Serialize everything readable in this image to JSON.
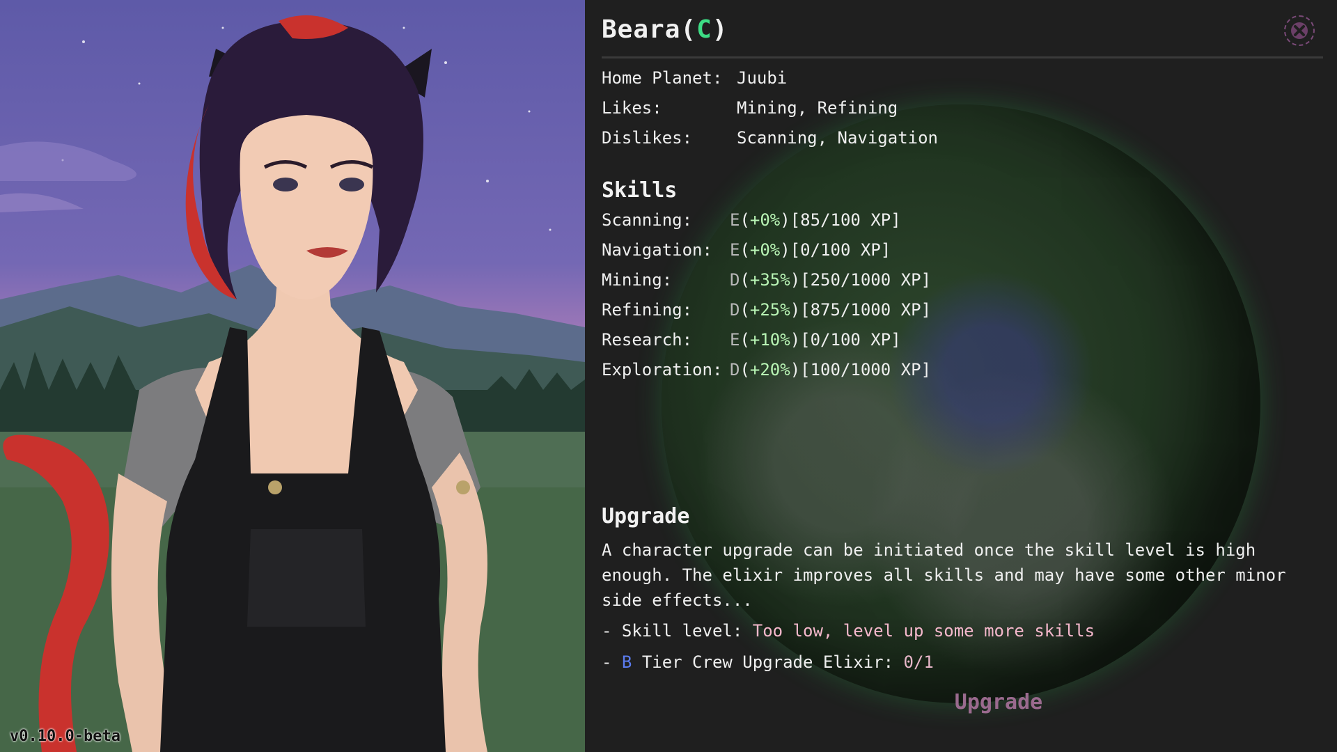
{
  "version": "v0.10.0-beta",
  "character": {
    "name": "Beara",
    "tier": "C",
    "home_planet_label": "Home Planet:",
    "home_planet": "Juubi",
    "likes_label": "Likes:",
    "likes": "Mining, Refining",
    "dislikes_label": "Dislikes:",
    "dislikes": "Scanning, Navigation"
  },
  "skills": {
    "heading": "Skills",
    "items": [
      {
        "label": "Scanning:",
        "grade": "E",
        "bonus": "+0%",
        "xp": "85/100 XP"
      },
      {
        "label": "Navigation:",
        "grade": "E",
        "bonus": "+0%",
        "xp": "0/100 XP"
      },
      {
        "label": "Mining:",
        "grade": "D",
        "bonus": "+35%",
        "xp": "250/1000 XP"
      },
      {
        "label": "Refining:",
        "grade": "D",
        "bonus": "+25%",
        "xp": "875/1000 XP"
      },
      {
        "label": "Research:",
        "grade": "E",
        "bonus": "+10%",
        "xp": "0/100 XP"
      },
      {
        "label": "Exploration:",
        "grade": "D",
        "bonus": "+20%",
        "xp": "100/1000 XP"
      }
    ]
  },
  "upgrade": {
    "heading": "Upgrade",
    "description": "A character upgrade can be initiated once the skill level is high enough. The elixir improves all skills and may have some other minor side effects...",
    "skill_level_label": "- Skill level:",
    "skill_level_status": "Too low, level up some more skills",
    "elixir_prefix": "-",
    "elixir_tier": "B",
    "elixir_label": "Tier Crew Upgrade Elixir:",
    "elixir_count": "0/1",
    "button_label": "Upgrade"
  },
  "colors": {
    "tier_accent": "#3ddc84",
    "bonus": "#b9f5b5",
    "warning": "#f5b8cc",
    "tier_b": "#5b7cf0",
    "upgrade_button": "#9a6a8e"
  },
  "icons": {
    "close": "close-icon"
  }
}
